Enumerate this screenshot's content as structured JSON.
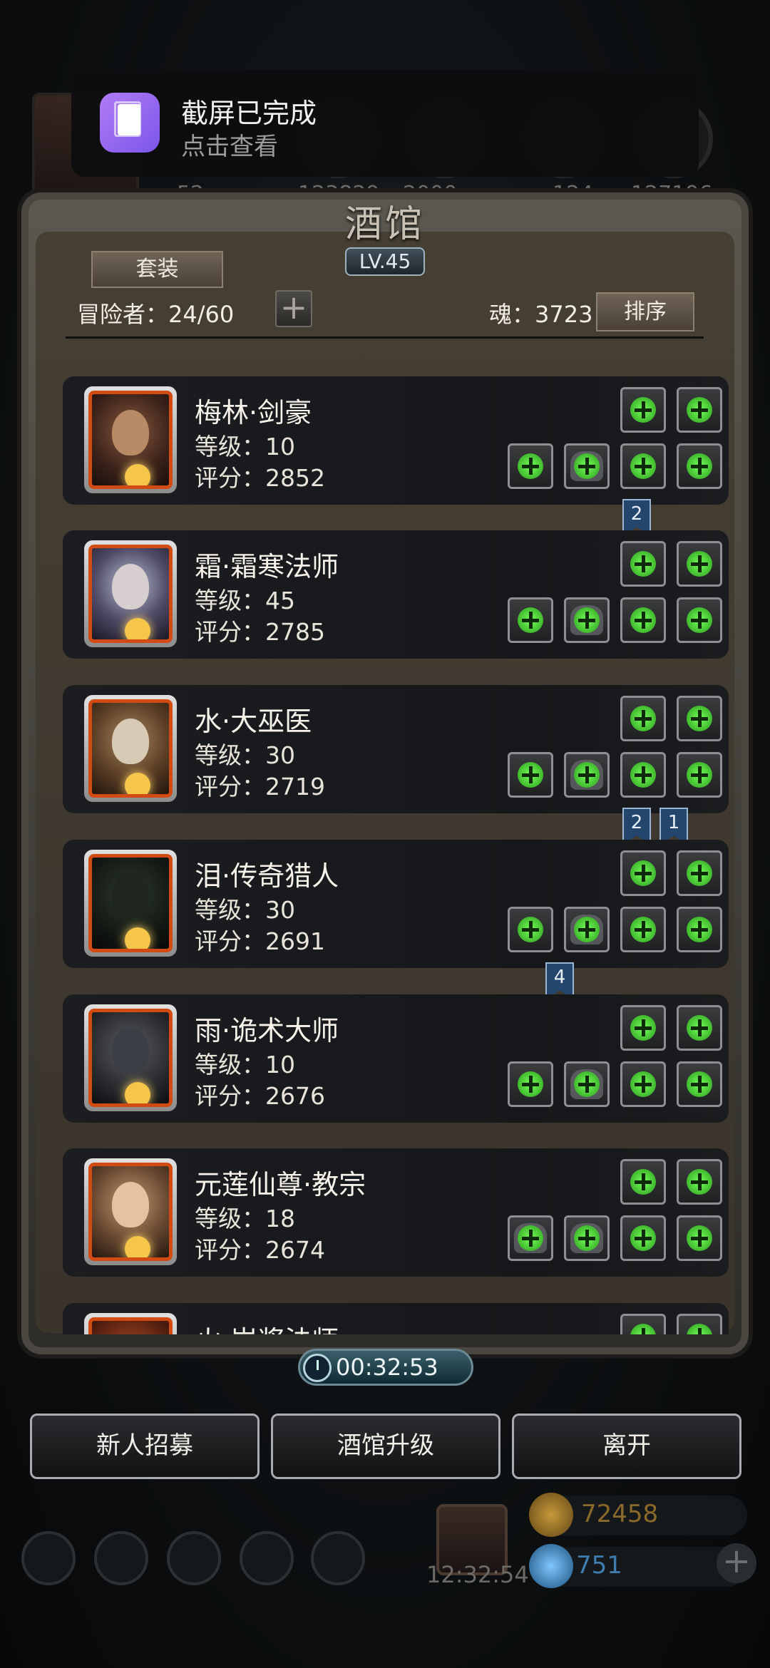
{
  "notification": {
    "title": "截屏已完成",
    "subtitle": "点击查看"
  },
  "background": {
    "top_stats": [
      "52",
      "123829",
      "2000",
      "124",
      "127196"
    ],
    "gift_timer": "12:32:54",
    "coins": "72458",
    "gems": "751"
  },
  "tavern": {
    "title": "酒馆",
    "level": "LV.45",
    "suit_button": "套装",
    "adventurers": "冒险者：24/60",
    "add_icon": "+",
    "soul": "魂：3723",
    "sort_button": "排序",
    "timer": "00:32:53"
  },
  "heroes": [
    {
      "name": "梅林·剑豪",
      "level": "等级：10",
      "score": "评分：2852"
    },
    {
      "name": "霜·霜寒法师",
      "level": "等级：45",
      "score": "评分：2785"
    },
    {
      "name": "水·大巫医",
      "level": "等级：30",
      "score": "评分：2719"
    },
    {
      "name": "泪·传奇猎人",
      "level": "等级：30",
      "score": "评分：2691"
    },
    {
      "name": "雨·诡术大师",
      "level": "等级：10",
      "score": "评分：2676"
    },
    {
      "name": "元莲仙尊·教宗",
      "level": "等级：18",
      "score": "评分：2674"
    },
    {
      "name": "火·岩浆法师",
      "level": "",
      "score": ""
    }
  ],
  "flags": [
    "2",
    "2",
    "1",
    "4"
  ],
  "bottom_buttons": {
    "recruit": "新人招募",
    "upgrade": "酒馆升级",
    "leave": "离开"
  },
  "icons": {
    "equipment_slot": "green-plus-icon",
    "portrait_badge": "crescent-moon-icon",
    "timer": "clock-icon"
  },
  "colors": {
    "accent_green": "#54e03a",
    "portrait_border": "#d24b13",
    "flag_blue": "#25466c"
  }
}
